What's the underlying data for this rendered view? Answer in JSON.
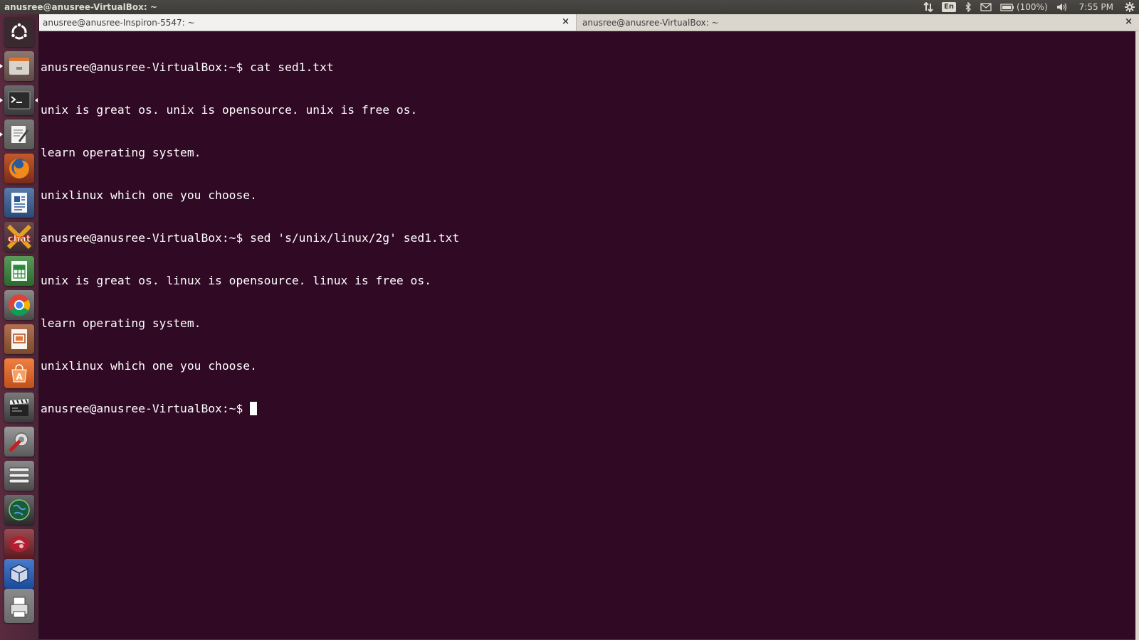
{
  "top_panel": {
    "title": "anusree@anusree-VirtualBox: ~",
    "lang": "En",
    "battery": "(100%)",
    "clock": "7:55 PM"
  },
  "launcher": {
    "items": [
      {
        "name": "dash",
        "icon": "ubuntu-logo-icon"
      },
      {
        "name": "files",
        "icon": "file-manager-icon"
      },
      {
        "name": "terminal",
        "icon": "terminal-icon"
      },
      {
        "name": "text-editor",
        "icon": "text-editor-icon"
      },
      {
        "name": "firefox",
        "icon": "firefox-icon"
      },
      {
        "name": "writer",
        "icon": "writer-document-icon"
      },
      {
        "name": "xchat",
        "icon": "xchat-icon",
        "label": "chat"
      },
      {
        "name": "calc",
        "icon": "spreadsheet-icon"
      },
      {
        "name": "chrome",
        "icon": "chrome-icon"
      },
      {
        "name": "impress",
        "icon": "presentation-icon"
      },
      {
        "name": "software-center",
        "icon": "software-center-icon"
      },
      {
        "name": "video",
        "icon": "video-editor-icon"
      },
      {
        "name": "system-settings",
        "icon": "system-tools-icon"
      },
      {
        "name": "storage",
        "icon": "disk-stack-icon"
      },
      {
        "name": "globe",
        "icon": "globe-icon"
      },
      {
        "name": "wine",
        "icon": "wine-icon"
      },
      {
        "name": "virtualbox",
        "icon": "virtualbox-icon"
      },
      {
        "name": "printer",
        "icon": "printer-icon"
      }
    ]
  },
  "tabs": [
    {
      "label": "anusree@anusree-Inspiron-5547: ~",
      "close": "×"
    },
    {
      "label": "anusree@anusree-VirtualBox: ~",
      "close": "×"
    }
  ],
  "terminal": {
    "lines": [
      "anusree@anusree-VirtualBox:~$ cat sed1.txt",
      "unix is great os. unix is opensource. unix is free os.",
      "learn operating system.",
      "unixlinux which one you choose.",
      "anusree@anusree-VirtualBox:~$ sed 's/unix/linux/2g' sed1.txt",
      "unix is great os. linux is opensource. linux is free os.",
      "learn operating system.",
      "unixlinux which one you choose.",
      "anusree@anusree-VirtualBox:~$ "
    ]
  },
  "colors": {
    "terminal_bg": "#300a24",
    "launcher_bg": "#5a2a3e",
    "panel_bg": "#3c3b37",
    "tabbar_bg": "#dad6ce"
  }
}
